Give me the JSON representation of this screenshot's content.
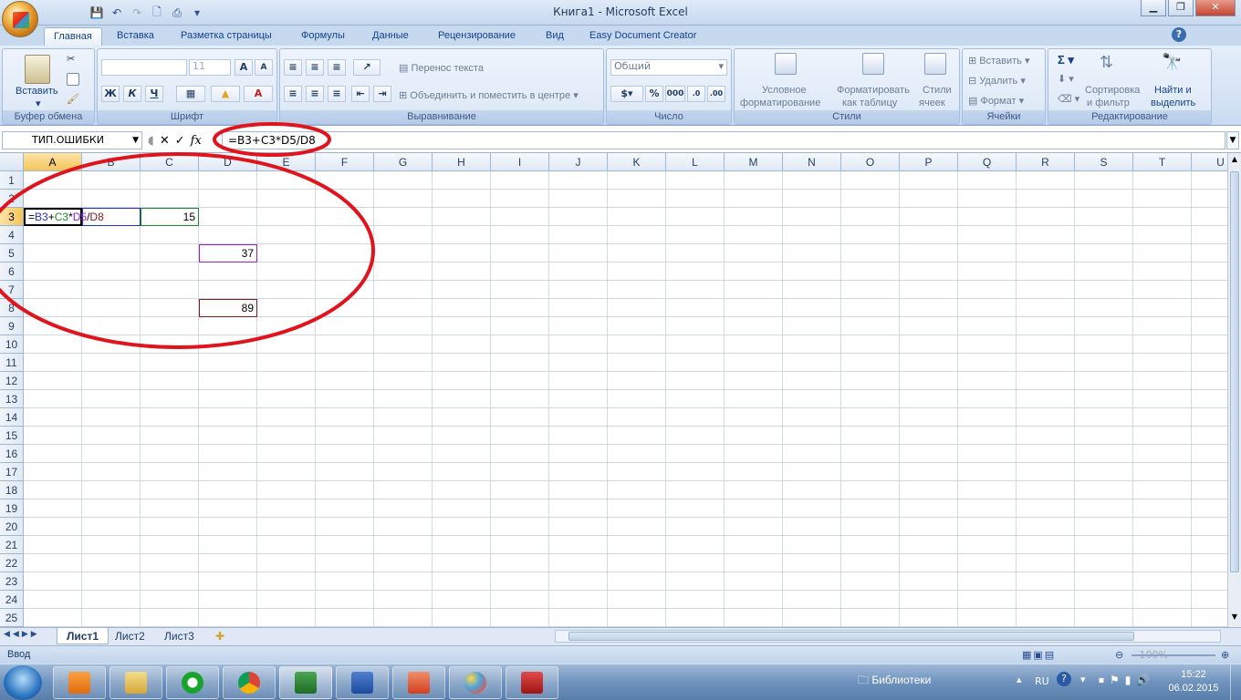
{
  "window": {
    "title": "Книга1 - Microsoft Excel"
  },
  "tabs": [
    "Главная",
    "Вставка",
    "Разметка страницы",
    "Формулы",
    "Данные",
    "Рецензирование",
    "Вид",
    "Easy Document Creator"
  ],
  "ribbon": {
    "clipboard": {
      "label": "Буфер обмена",
      "paste": "Вставить"
    },
    "font": {
      "label": "Шрифт",
      "size": "11",
      "bold": "Ж",
      "italic": "К",
      "underline": "Ч"
    },
    "alignment": {
      "label": "Выравнивание",
      "wrap": "Перенос текста",
      "merge": "Объединить и поместить в центре"
    },
    "number": {
      "label": "Число",
      "format": "Общий",
      "percent": "%",
      "thousands": "000"
    },
    "styles": {
      "label": "Стили",
      "cond_1": "Условное",
      "cond_2": "форматирование",
      "table_1": "Форматировать",
      "table_2": "как таблицу",
      "cell_1": "Стили",
      "cell_2": "ячеек"
    },
    "cells": {
      "label": "Ячейки",
      "insert": "Вставить",
      "delete": "Удалить",
      "format": "Формат"
    },
    "editing": {
      "label": "Редактирование",
      "sort_1": "Сортировка",
      "sort_2": "и фильтр",
      "find_1": "Найти и",
      "find_2": "выделить"
    }
  },
  "formula_bar": {
    "name_box": "ТИП.ОШИБКИ",
    "fx": "fx",
    "cancel": "✕",
    "enter": "✓",
    "formula": "=B3+C3*D5/D8"
  },
  "columns": [
    "A",
    "B",
    "C",
    "D",
    "E",
    "F",
    "G",
    "H",
    "I",
    "J",
    "K",
    "L",
    "M",
    "N",
    "O",
    "P",
    "Q",
    "R",
    "S",
    "T",
    "U"
  ],
  "rows": [
    "1",
    "2",
    "3",
    "4",
    "5",
    "6",
    "7",
    "8",
    "9",
    "10",
    "11",
    "12",
    "13",
    "14",
    "15",
    "16",
    "17",
    "18",
    "19",
    "20",
    "21",
    "22",
    "23",
    "24",
    "25"
  ],
  "cells": {
    "a3": {
      "p1": "=",
      "p2": "B3",
      "p3": "+",
      "p4": "C3",
      "p5": "*",
      "p6": "D5",
      "p7": "/",
      "p8": "D8"
    },
    "c3": "15",
    "d5": "37",
    "d8": "89"
  },
  "sheets": [
    "Лист1",
    "Лист2",
    "Лист3"
  ],
  "status": {
    "mode": "Ввод",
    "zoom": "100%"
  },
  "taskbar": {
    "libraries": "Библиотеки",
    "lang": "RU",
    "time": "15:22",
    "date": "06.02.2015"
  },
  "colors": {
    "red_annotation": "#e0141c",
    "ref_blue": "#1f2fd0",
    "ref_green": "#1c8a2a",
    "ref_purple": "#9a22c9",
    "ref_maroon": "#8a1a1a"
  }
}
